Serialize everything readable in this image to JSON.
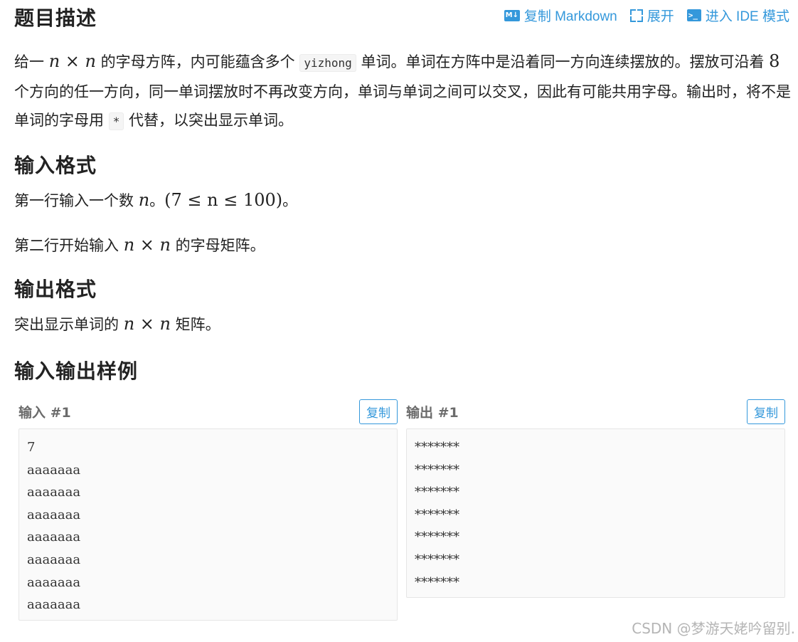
{
  "header": {
    "title": "题目描述",
    "actions": {
      "copy_md": "复制 Markdown",
      "expand": "展开",
      "ide": "进入 IDE 模式",
      "md_icon_text": "M↓",
      "ide_icon_text": ">_"
    }
  },
  "description": {
    "p1_a": "给一 ",
    "p1_math": "n × n",
    "p1_b": " 的字母方阵，内可能蕴含多个 ",
    "p1_code": "yizhong",
    "p1_c": " 单词。单词在方阵中是沿着同一方向连续摆放的。摆放可沿着 ",
    "p1_num": "8",
    "p1_d": " 个方向的任一方向，同一单词摆放时不再改变方向，单词与单词之间可以交叉，因此有可能共用字母。输出时，将不是单词的字母用 ",
    "p1_code2": "*",
    "p1_e": " 代替，以突出显示单词。"
  },
  "input_format": {
    "title": "输入格式",
    "line1_a": "第一行输入一个数 ",
    "line1_math": "n",
    "line1_b": "。",
    "line1_range": "(7 ≤ n ≤ 100)",
    "line1_c": "。",
    "line2_a": "第二行开始输入 ",
    "line2_math": "n × n",
    "line2_b": " 的字母矩阵。"
  },
  "output_format": {
    "title": "输出格式",
    "line_a": "突出显示单词的 ",
    "line_math": "n × n",
    "line_b": " 矩阵。"
  },
  "samples": {
    "title": "输入输出样例",
    "input_title": "输入 #1",
    "output_title": "输出 #1",
    "copy_label": "复制",
    "input_text": "7\naaaaaaa\naaaaaaa\naaaaaaa\naaaaaaa\naaaaaaa\naaaaaaa\naaaaaaa",
    "output_text": "*******\n*******\n*******\n*******\n*******\n*******\n*******"
  },
  "watermark": "CSDN @梦游天姥吟留别."
}
